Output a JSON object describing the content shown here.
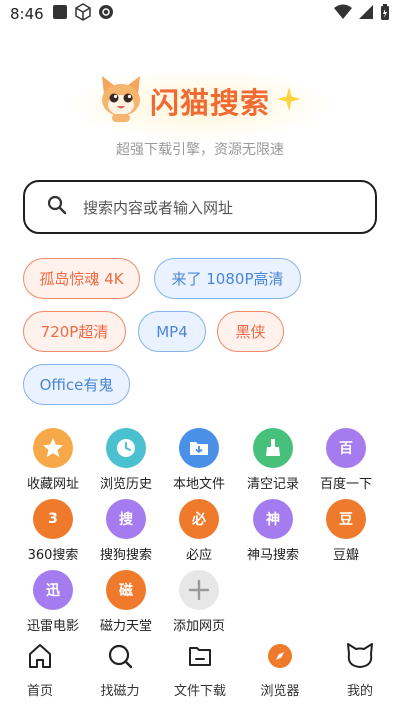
{
  "status_bar": {
    "time": "8:46"
  },
  "brand": {
    "name": "闪猫搜索",
    "slogan": "超强下载引擎，资源无限速"
  },
  "search": {
    "placeholder": "搜索内容或者输入网址"
  },
  "chips": [
    {
      "label": "孤岛惊魂 4K",
      "style": "red"
    },
    {
      "label": "来了 1080P高清",
      "style": "blue"
    },
    {
      "label": "720P超清",
      "style": "red"
    },
    {
      "label": "MP4",
      "style": "blue"
    },
    {
      "label": "黑侠",
      "style": "red"
    },
    {
      "label": "Office有鬼",
      "style": "blue"
    }
  ],
  "shortcuts": [
    {
      "label": "收藏网址",
      "icon": "star-icon",
      "color": "#f7a94a"
    },
    {
      "label": "浏览历史",
      "icon": "clock-icon",
      "color": "#4bc0cf"
    },
    {
      "label": "本地文件",
      "icon": "folder-download-icon",
      "color": "#4a90e8"
    },
    {
      "label": "清空记录",
      "icon": "broom-icon",
      "color": "#46c07a"
    },
    {
      "label": "百度一下",
      "glyph": "百",
      "color": "#a57bf0"
    },
    {
      "label": "360搜索",
      "glyph": "3",
      "color": "#f07a2b"
    },
    {
      "label": "搜狗搜索",
      "glyph": "搜",
      "color": "#a57bf0"
    },
    {
      "label": "必应",
      "glyph": "必",
      "color": "#f07a2b"
    },
    {
      "label": "神马搜索",
      "glyph": "神",
      "color": "#a57bf0"
    },
    {
      "label": "豆瓣",
      "glyph": "豆",
      "color": "#f07a2b"
    },
    {
      "label": "迅雷电影",
      "glyph": "迅",
      "color": "#a57bf0"
    },
    {
      "label": "磁力天堂",
      "glyph": "磁",
      "color": "#f07a2b"
    },
    {
      "label": "添加网页",
      "icon": "plus-icon",
      "color": "#e7e7e7"
    }
  ],
  "nav": [
    {
      "label": "首页",
      "icon": "home-icon"
    },
    {
      "label": "找磁力",
      "icon": "search-icon"
    },
    {
      "label": "文件下载",
      "icon": "file-icon"
    },
    {
      "label": "浏览器",
      "icon": "compass-icon"
    },
    {
      "label": "我的",
      "icon": "cat-head-icon"
    }
  ]
}
